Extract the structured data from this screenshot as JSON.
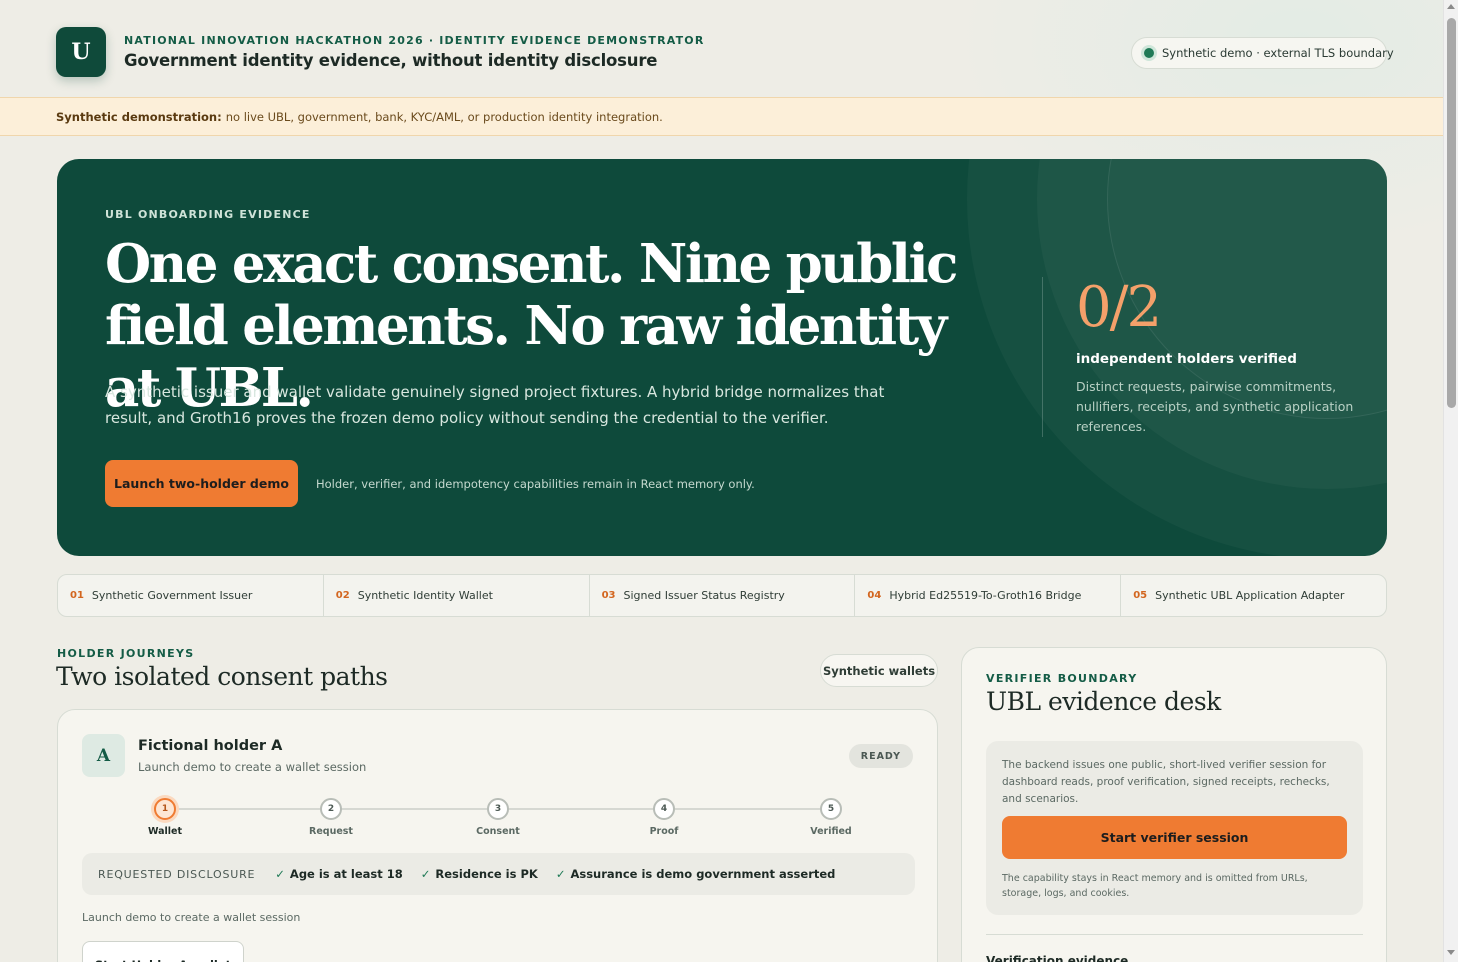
{
  "header": {
    "logo_letter": "U",
    "eyebrow": "NATIONAL INNOVATION HACKATHON 2026 · IDENTITY EVIDENCE DEMONSTRATOR",
    "title": "Government identity evidence, without identity disclosure",
    "status_pill": "Synthetic demo · external TLS boundary"
  },
  "banner": {
    "label": "Synthetic demonstration:",
    "text": "no live UBL, government, bank, KYC/AML, or production identity integration."
  },
  "hero": {
    "eyebrow": "UBL ONBOARDING EVIDENCE",
    "headline": "One exact consent. Nine public field elements. No raw identity at UBL.",
    "body": "A synthetic issuer and wallet validate genuinely signed project fixtures. A hybrid bridge normalizes that result, and Groth16 proves the frozen demo policy without sending the credential to the verifier.",
    "launch_button": "Launch two-holder demo",
    "launch_note": "Holder, verifier, and idempotency capabilities remain in React memory only.",
    "stat_value": "0/2",
    "stat_label": "independent holders verified",
    "stat_desc": "Distinct requests, pairwise commitments, nullifiers, receipts, and synthetic application references."
  },
  "pipeline": [
    {
      "num": "01",
      "label": "Synthetic Government Issuer"
    },
    {
      "num": "02",
      "label": "Synthetic Identity Wallet"
    },
    {
      "num": "03",
      "label": "Signed Issuer Status Registry"
    },
    {
      "num": "04",
      "label": "Hybrid Ed25519-To-Groth16 Bridge"
    },
    {
      "num": "05",
      "label": "Synthetic UBL Application Adapter"
    }
  ],
  "journeys": {
    "eyebrow": "HOLDER JOURNEYS",
    "title": "Two isolated consent paths",
    "pill": "Synthetic wallets",
    "holder_a": {
      "avatar": "A",
      "name": "Fictional holder A",
      "subtitle": "Launch demo to create a wallet session",
      "badge": "READY",
      "steps": [
        {
          "num": "1",
          "label": "Wallet"
        },
        {
          "num": "2",
          "label": "Request"
        },
        {
          "num": "3",
          "label": "Consent"
        },
        {
          "num": "4",
          "label": "Proof"
        },
        {
          "num": "5",
          "label": "Verified"
        }
      ],
      "disclosure_label": "REQUESTED DISCLOSURE",
      "disclosures": [
        "Age is at least 18",
        "Residence is PK",
        "Assurance is demo government asserted"
      ],
      "status": "Launch demo to create a wallet session",
      "button": "Start Holder A wallet"
    }
  },
  "verifier": {
    "eyebrow": "VERIFIER BOUNDARY",
    "title": "UBL evidence desk",
    "desc": "The backend issues one public, short-lived verifier session for dashboard reads, proof verification, signed receipts, rechecks, and scenarios.",
    "button": "Start verifier session",
    "note": "The capability stays in React memory and is omitted from URLs, storage, logs, and cookies.",
    "peek": "Verification evidence"
  },
  "icons": {
    "status_dot": "status-dot-icon",
    "check": "check-icon"
  },
  "colors": {
    "brand_green": "#0e4a3b",
    "accent_orange": "#ef7b32",
    "banner_bg": "#fcefd9"
  }
}
